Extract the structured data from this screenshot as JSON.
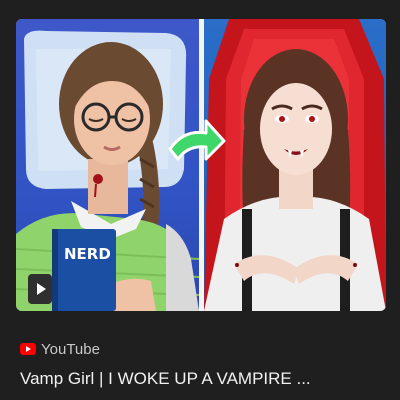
{
  "result": {
    "thumbnail": {
      "book_label": "NERD",
      "colors": {
        "left_background": "#3153c4",
        "right_background": "#1e5bb3",
        "arrow": "#3fd66a",
        "coffin_red": "#c4141c",
        "book": "#1a4fa3",
        "sweater": "#8fd36b"
      }
    },
    "play_icon": "play-icon",
    "source": {
      "icon": "youtube-logo-icon",
      "name": "YouTube",
      "brand_color": "#ff0000"
    },
    "title": "Vamp Girl | I WOKE UP A VAMPIRE ..."
  }
}
